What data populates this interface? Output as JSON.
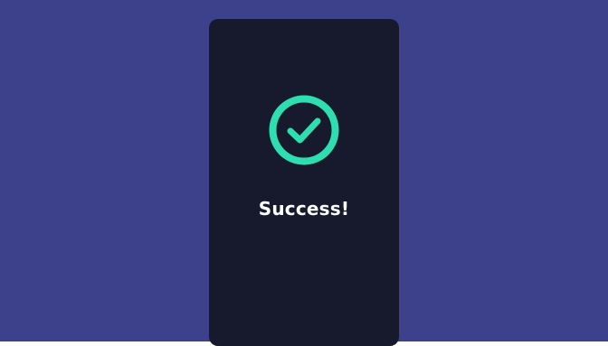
{
  "status": {
    "message": "Success!",
    "icon": "check-circle-icon"
  },
  "colors": {
    "background": "#3d408a",
    "card": "#171a2c",
    "accent": "#2ddfb0",
    "text": "#ffffff"
  }
}
